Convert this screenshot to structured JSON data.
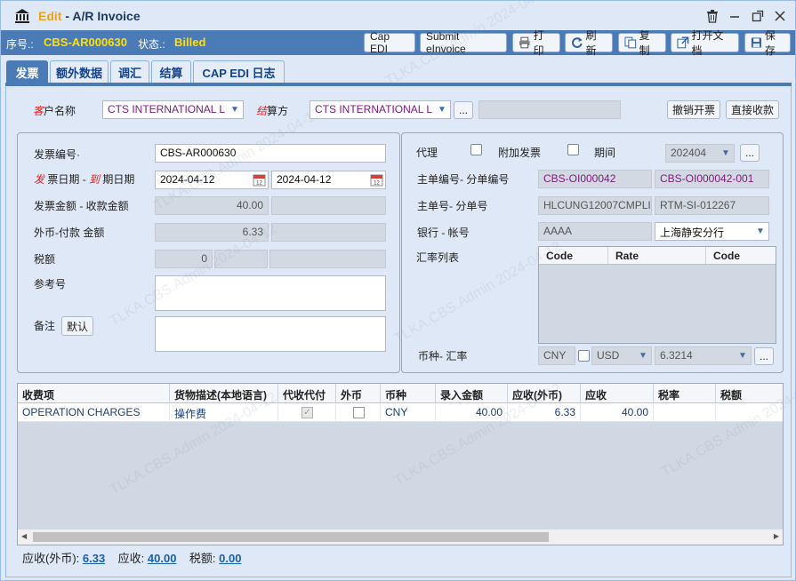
{
  "window": {
    "mode": "Edit",
    "title": "A/R Invoice",
    "watermark": "TLKA.CBS.Admin 2024-04-12"
  },
  "status": {
    "seq_label": "序号.:",
    "seq_value": "CBS-AR000630",
    "state_label": "状态.:",
    "state_value": "Billed",
    "buttons": {
      "cap_edi": "Cap EDI",
      "submit_einvoice": "Submit eInvoice",
      "print": "打印",
      "refresh": "刷新",
      "copy": "复制",
      "open_doc": "打开文档",
      "save": "保存"
    }
  },
  "tabs": [
    "发票",
    "额外数据",
    "调汇",
    "结算",
    "CAP EDI 日志"
  ],
  "customer": {
    "label_red": "客",
    "label_rest": "户名称",
    "value": "CTS INTERNATIONAL L",
    "settle_red": "结",
    "settle_rest": "算方",
    "settle_value": "CTS INTERNATIONAL L",
    "more_btn": "...",
    "cancel_btn": "撤销开票",
    "direct_btn": "直接收款"
  },
  "left": {
    "invoice_no_label": "发票编号·",
    "invoice_no": "CBS-AR000630",
    "date_red1": "发",
    "date_mid": "票日期 -",
    "date_red2": "到",
    "date_rest": "期日期",
    "invoice_date": "2024-04-12",
    "due_date": "2024-04-12",
    "amount_label": "发票金额 - 收款金额",
    "amount": "40.00",
    "fc_label": "外币-付款 金额",
    "fc_amount": "6.33",
    "tax_label": "税额",
    "tax": "0",
    "ref_label": "参考号",
    "remark_label": "备注",
    "default_btn": "默认"
  },
  "right": {
    "agent_label": "代理",
    "extra_label": "附加发票",
    "period_label": "期间",
    "period": "202404",
    "more_btn": "...",
    "main_no_label": "主单编号- 分单编号",
    "main_no": "CBS-OI000042",
    "sub_no": "CBS-OI000042-001",
    "mbl_label": "主单号- 分单号",
    "mbl": "HLCUNG12007CMPLI",
    "hbl": "RTM-SI-012267",
    "bank_label": "银行 -  帐号",
    "bank": "AAAA",
    "account": "上海静安分行",
    "rate_list_label": "汇率列表",
    "rate_cols": [
      "Code",
      "Rate",
      "Code"
    ],
    "currency_label": "币种- 汇率",
    "currency": "CNY",
    "fx_currency": "USD",
    "fx_rate": "6.3214"
  },
  "grid": {
    "columns": [
      "收费项",
      "货物描述(本地语言)",
      "代收代付",
      "外币",
      "币种",
      "录入金额",
      "应收(外币)",
      "应收",
      "税率",
      "税额"
    ],
    "rows": [
      {
        "item": "OPERATION CHARGES",
        "desc": "操作费",
        "collect": true,
        "fc": false,
        "currency": "CNY",
        "input_amount": "40.00",
        "ar_fc": "6.33",
        "ar": "40.00",
        "tax_rate": "",
        "tax": ""
      }
    ]
  },
  "footer": {
    "fc_label": "应收(外币):",
    "fc_value": "6.33",
    "ar_label": "应收:",
    "ar_value": "40.00",
    "tax_label": "税额:",
    "tax_value": "0.00"
  }
}
